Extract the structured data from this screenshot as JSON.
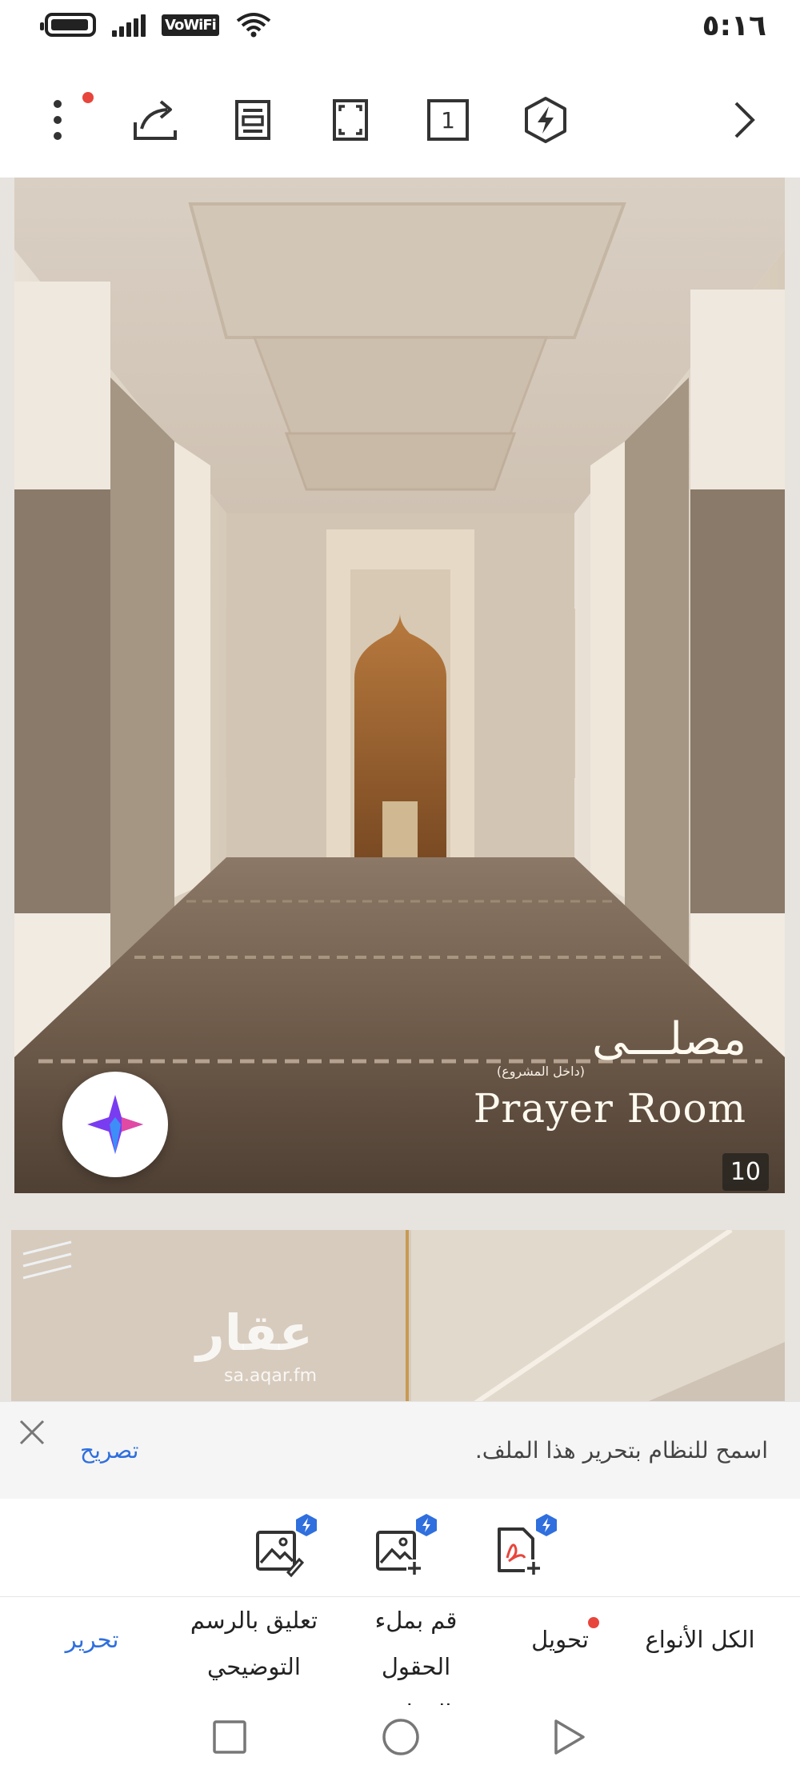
{
  "status_bar": {
    "network_label": "VoWiFi",
    "time": "٥:١٦"
  },
  "toolbar": {
    "page_indicator": "1",
    "icons": [
      "more-menu-icon",
      "share-icon",
      "reading-mode-icon",
      "fullscreen-icon",
      "page-number-icon",
      "ai-tools-icon",
      "forward-icon"
    ]
  },
  "document": {
    "caption_arabic": "مصلـــى",
    "caption_sub": "(داخل المشروع)",
    "caption_english": "Prayer Room",
    "page_number": "10",
    "watermark_arabic": "عقار",
    "watermark_url": "sa.aqar.fm"
  },
  "permission_bar": {
    "message": "اسمح للنظام بتحرير هذا الملف.",
    "allow_label": "تصريح"
  },
  "tools": {
    "items": [
      "annotate-image-icon",
      "insert-image-icon",
      "convert-pdf-icon"
    ]
  },
  "bottom_nav": {
    "all_types": "الكل الأنواع",
    "convert": "تحويل",
    "fill_line1": "قم بملء",
    "fill_line2": "الحقول المط...",
    "comment_line1": "تعليق بالرسم",
    "comment_line2": "التوضيحي",
    "edit": "تحرير"
  },
  "colors": {
    "accent": "#2f6fde",
    "notification_dot": "#e8453c"
  }
}
